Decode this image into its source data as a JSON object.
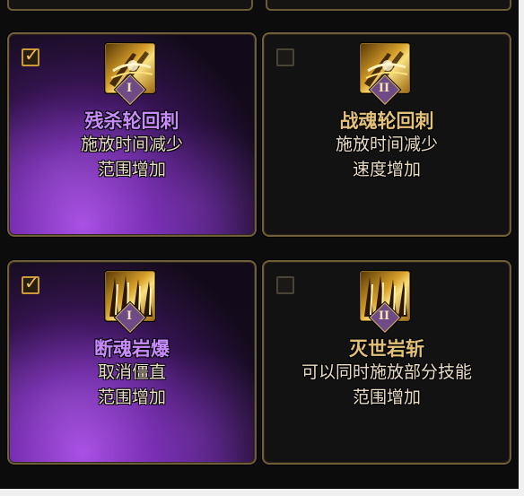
{
  "colors": {
    "selected_title": "#c98cff",
    "unselected_title": "#e3c278",
    "frame_gold": "#6f5e38",
    "selected_glow": "#8a3ad0"
  },
  "skills": [
    {
      "name": "残杀轮回刺",
      "effects": [
        "施放时间减少",
        "范围增加"
      ],
      "rank": "I",
      "selected": true,
      "icon": "blade-slash-icon"
    },
    {
      "name": "战魂轮回刺",
      "effects": [
        "施放时间减少",
        "速度增加"
      ],
      "rank": "II",
      "selected": false,
      "icon": "blade-slash-icon"
    },
    {
      "name": "断魂岩爆",
      "effects": [
        "取消僵直",
        "范围增加"
      ],
      "rank": "I",
      "selected": true,
      "icon": "rock-spikes-icon"
    },
    {
      "name": "灭世岩斩",
      "effects": [
        "可以同时施放部分技能",
        "范围增加"
      ],
      "rank": "II",
      "selected": false,
      "icon": "rock-spikes-icon"
    }
  ]
}
